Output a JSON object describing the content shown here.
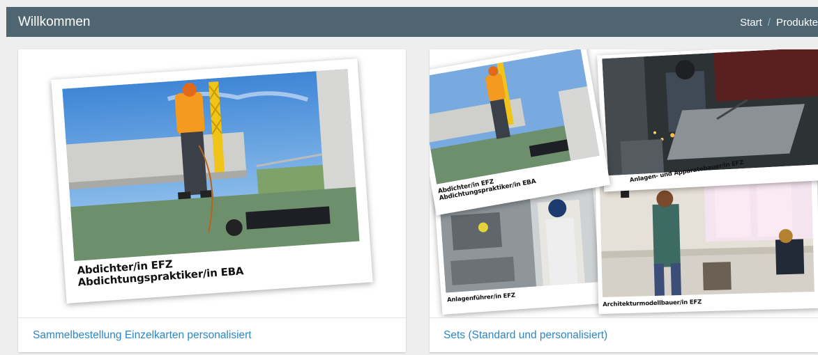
{
  "header": {
    "title": "Willkommen",
    "breadcrumb": [
      {
        "label": "Start"
      },
      {
        "label": "Produkte"
      }
    ],
    "separator": "/"
  },
  "cards": [
    {
      "link": "Sammelbestellung Einzelkarten personalisiert",
      "photo_caption": {
        "line1": "Abdichter/in EFZ",
        "line2": "Abdichtungspraktiker/in EBA"
      }
    },
    {
      "link": "Sets (Standard und personalisiert)",
      "photos": [
        {
          "line1": "Abdichter/in EFZ",
          "line2": "Abdichtungspraktiker/in EBA"
        },
        {
          "line1": "Anlagen- und Apparatebauer/in EFZ"
        },
        {
          "line1": "Anlagenführer/in EFZ"
        },
        {
          "line1": "Architekturmodellbauer/in EFZ"
        }
      ]
    }
  ],
  "colors": {
    "header_bg": "#4f6571",
    "link": "#2a86c7",
    "page_bg": "#eeeeee"
  }
}
